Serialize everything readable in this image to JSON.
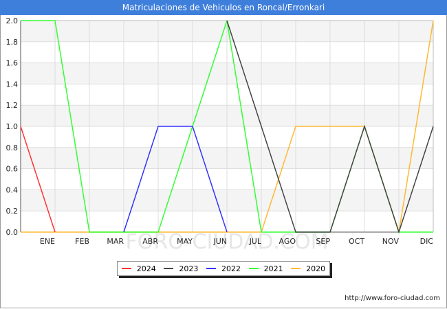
{
  "title": "Matriculaciones de Vehiculos en Roncal/Erronkari",
  "watermark": "FORO-CIUDAD.COM",
  "credit": "http://www.foro-ciudad.com",
  "chart_data": {
    "type": "line",
    "title": "Matriculaciones de Vehiculos en Roncal/Erronkari",
    "categories": [
      "",
      "ENE",
      "FEB",
      "MAR",
      "ABR",
      "MAY",
      "JUN",
      "JUL",
      "AGO",
      "SEP",
      "OCT",
      "NOV",
      "DIC"
    ],
    "y_ticks": [
      "0.0",
      "0.2",
      "0.4",
      "0.6",
      "0.8",
      "1.0",
      "1.2",
      "1.4",
      "1.6",
      "1.8",
      "2.0"
    ],
    "ylim": [
      0,
      2
    ],
    "grid": true,
    "legend": "bottom",
    "series": [
      {
        "name": "2020",
        "color": "#ffb833",
        "values": [
          0,
          0,
          0,
          0,
          0,
          0,
          0,
          0,
          1,
          1,
          1,
          0,
          2
        ]
      },
      {
        "name": "2021",
        "color": "#33ff33",
        "values": [
          2,
          2,
          0,
          0,
          0,
          1,
          2,
          0,
          0,
          0,
          1,
          0,
          0
        ]
      },
      {
        "name": "2022",
        "color": "#3333ff",
        "values": [
          null,
          null,
          null,
          0,
          1,
          1,
          0,
          null,
          null,
          null,
          null,
          null,
          null
        ]
      },
      {
        "name": "2023",
        "color": "#444444",
        "values": [
          null,
          null,
          null,
          null,
          null,
          null,
          2,
          1,
          0,
          0,
          1,
          0,
          1
        ]
      },
      {
        "name": "2024",
        "color": "#ff3333",
        "values": [
          1,
          0,
          null,
          null,
          null,
          null,
          null,
          null,
          null,
          null,
          null,
          null,
          null
        ]
      }
    ],
    "legend_order": [
      "2024",
      "2023",
      "2022",
      "2021",
      "2020"
    ]
  }
}
